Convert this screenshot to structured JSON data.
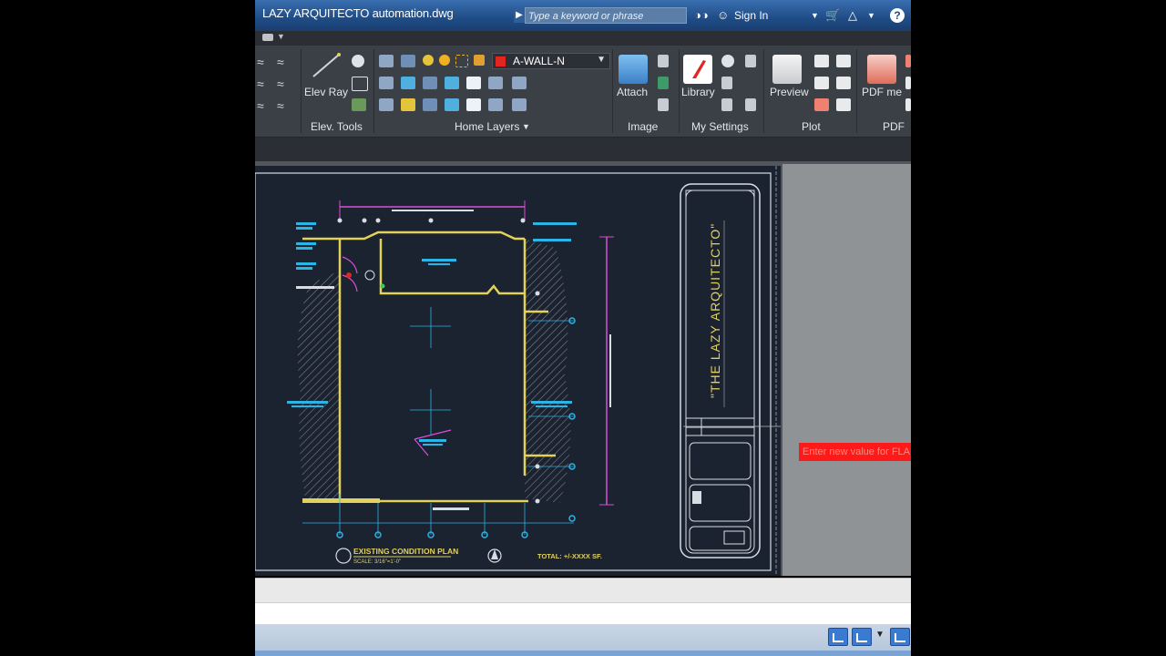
{
  "app": {
    "window_title": "LAZY ARQUITECTO automation.dwg",
    "search_placeholder": "Type a keyword or phrase",
    "sign_in": "Sign In"
  },
  "ribbon": {
    "tools": {
      "elev_ray": "Elev Ray"
    },
    "layer_combo": {
      "value": "A-WALL-N",
      "swatch_color": "#e0261e"
    },
    "buttons": {
      "attach": "Attach",
      "library": "Library",
      "preview": "Preview",
      "pdf": "PDF me"
    },
    "panels": {
      "elev_tools": "Elev. Tools",
      "home_layers": "Home Layers",
      "image": "Image",
      "my_settings": "My Settings",
      "plot": "Plot",
      "pdf": "PDF"
    }
  },
  "drawing": {
    "title_block_name": "\"THE LAZY ARQUITECTO\"",
    "plan_title": "EXISTING CONDITION PLAN",
    "plan_scale": "SCALE: 3/16\"=1'-0\"",
    "total_area": "TOTAL: +/-XXXX SF.",
    "dynamic_input": "Enter new value for FLA"
  },
  "colors": {
    "wall": "#e3d25a",
    "dimension": "#d94fd9",
    "grid": "#2bb4e6",
    "background": "#1b2230"
  }
}
